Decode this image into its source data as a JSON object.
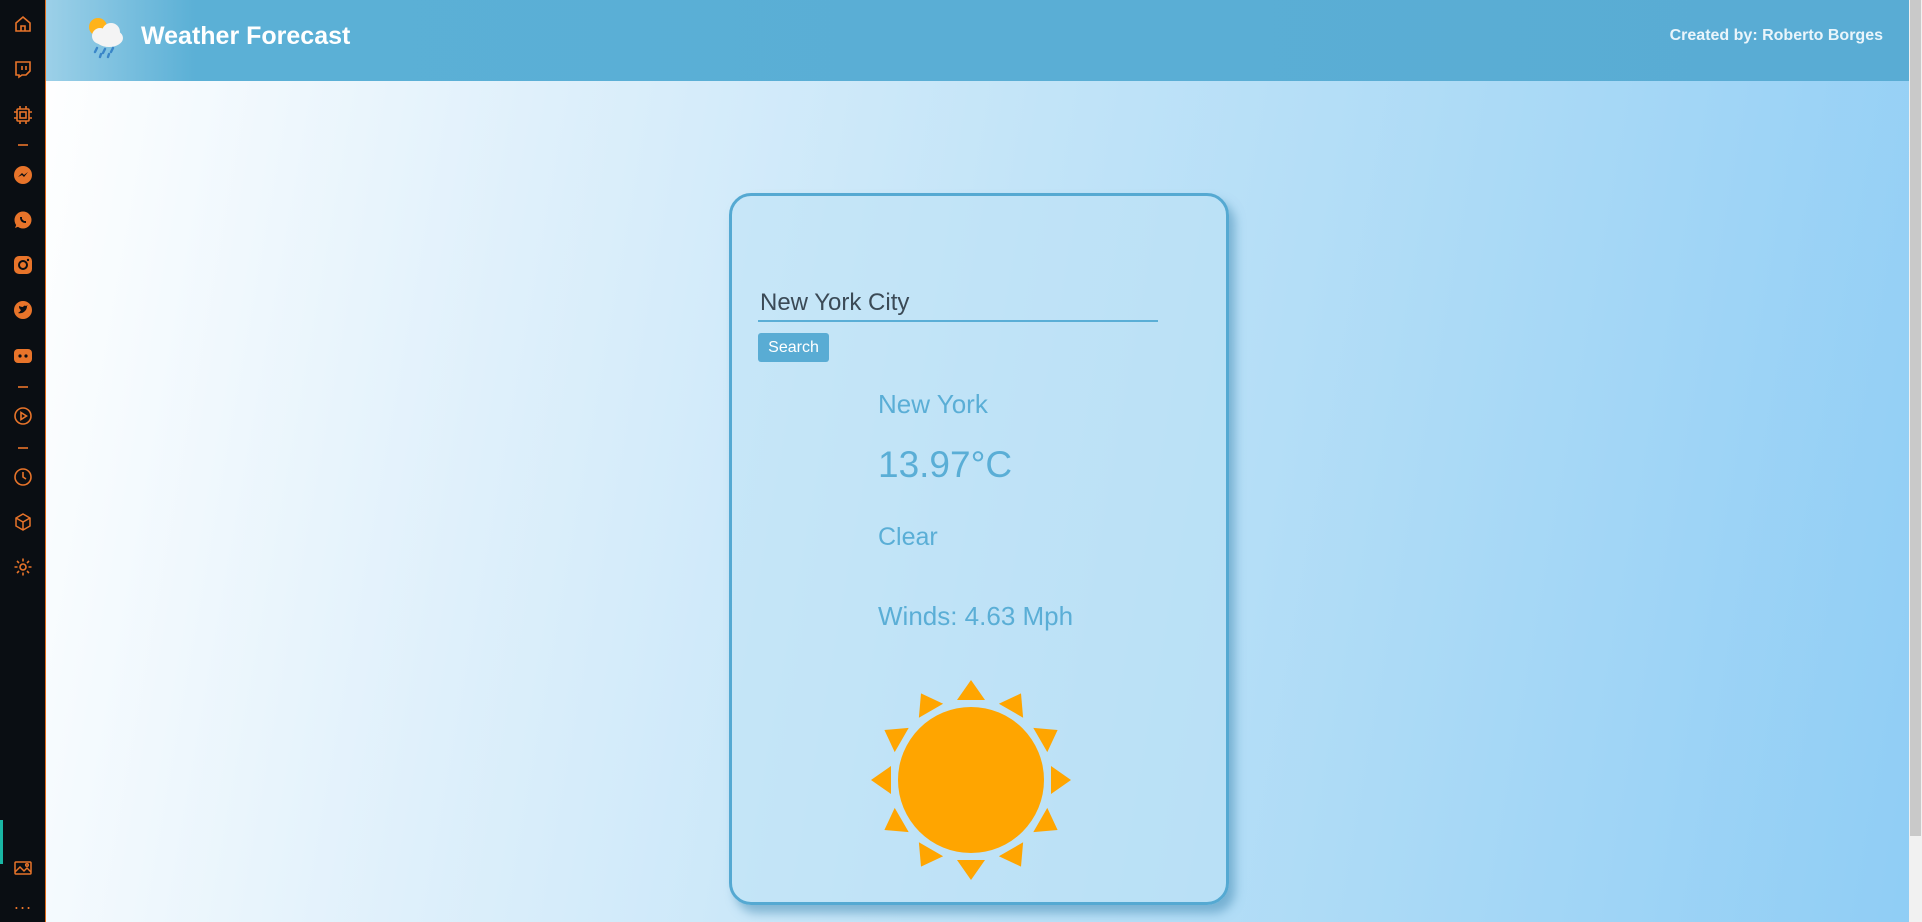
{
  "sidebar": {
    "icons": [
      "home-icon",
      "twitch-icon",
      "chip-icon",
      "messenger-icon",
      "whatsapp-icon",
      "instagram-icon",
      "twitter-icon",
      "discord-icon",
      "play-icon",
      "clock-icon",
      "box-icon",
      "settings-icon",
      "gallery-icon",
      "more-icon"
    ],
    "more_label": "..."
  },
  "header": {
    "title": "Weather Forecast",
    "credit": "Created by: Roberto Borges"
  },
  "search": {
    "value": "New York City",
    "button_label": "Search"
  },
  "weather": {
    "city": "New York",
    "temperature": "13.97°C",
    "condition": "Clear",
    "winds": "Winds: 4.63 Mph",
    "icon": "sun-icon"
  },
  "colors": {
    "accent": "#59acd4",
    "sun": "#ffa500",
    "sidebar_icon": "#e8742a"
  }
}
